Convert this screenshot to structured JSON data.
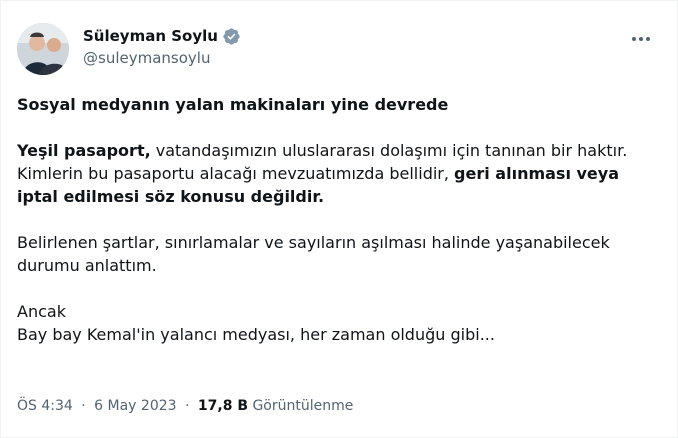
{
  "author": {
    "display_name": "Süleyman Soylu",
    "handle": "@suleymansoylu",
    "verified_icon": "verified-badge-icon",
    "avatar": "avatar-photo"
  },
  "more_icon": "more-options-icon",
  "tweet": {
    "headline": "Sosyal medyanın yalan makinaları yine devrede",
    "p1_bold": "Yeşil pasaport,",
    "p1_rest": " vatandaşımızın uluslararası dolaşımı için tanınan bir haktır.",
    "p2_plain": "Kimlerin bu pasaportu alacağı mevzuatımızda bellidir, ",
    "p2_bold": "geri alınması veya iptal edilmesi söz konusu değildir.",
    "p3": "Belirlenen şartlar, sınırlamalar ve sayıların aşılması halinde yaşanabilecek durumu anlattım.",
    "p4_line1": "Ancak",
    "p4_line2": "Bay bay Kemal'in yalancı medyası, her zaman olduğu gibi..."
  },
  "meta": {
    "time": "ÖS 4:34",
    "separator": "·",
    "date": "6 May 2023",
    "views_count": "17,8 B",
    "views_label": "Görüntülenme"
  },
  "colors": {
    "verified_badge": "#829aab",
    "secondary_text": "#536471",
    "primary_text": "#0f1419"
  }
}
